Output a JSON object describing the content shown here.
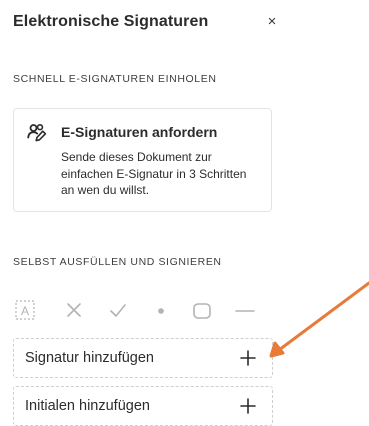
{
  "panel": {
    "title": "Elektronische Signaturen",
    "close_glyph": "×"
  },
  "section_request": {
    "heading": "SCHNELL E-SIGNATUREN EINHOLEN",
    "card": {
      "icon": "request-signatures-icon",
      "title": "E-Signaturen anfordern",
      "description": "Sende dieses Dokument zur einfachen E-Signatur in 3 Schritten an wen du willst."
    }
  },
  "section_fill_sign": {
    "heading": "SELBST AUSFÜLLEN UND SIGNIEREN",
    "tools": [
      {
        "icon": "text-field-icon"
      },
      {
        "icon": "cross-mark-icon"
      },
      {
        "icon": "check-mark-icon"
      },
      {
        "icon": "dot-icon"
      },
      {
        "icon": "rounded-rectangle-icon"
      },
      {
        "icon": "line-icon"
      }
    ],
    "actions": [
      {
        "label": "Signatur hinzufügen",
        "icon": "plus-icon"
      },
      {
        "label": "Initialen hinzufügen",
        "icon": "plus-icon"
      }
    ]
  },
  "colors": {
    "arrow": "#e87a3a",
    "tool_icons": "#b3b3b3",
    "text": "#2c2c2c",
    "card_border": "#e4e4e4",
    "row_border": "#cfcfcf"
  }
}
